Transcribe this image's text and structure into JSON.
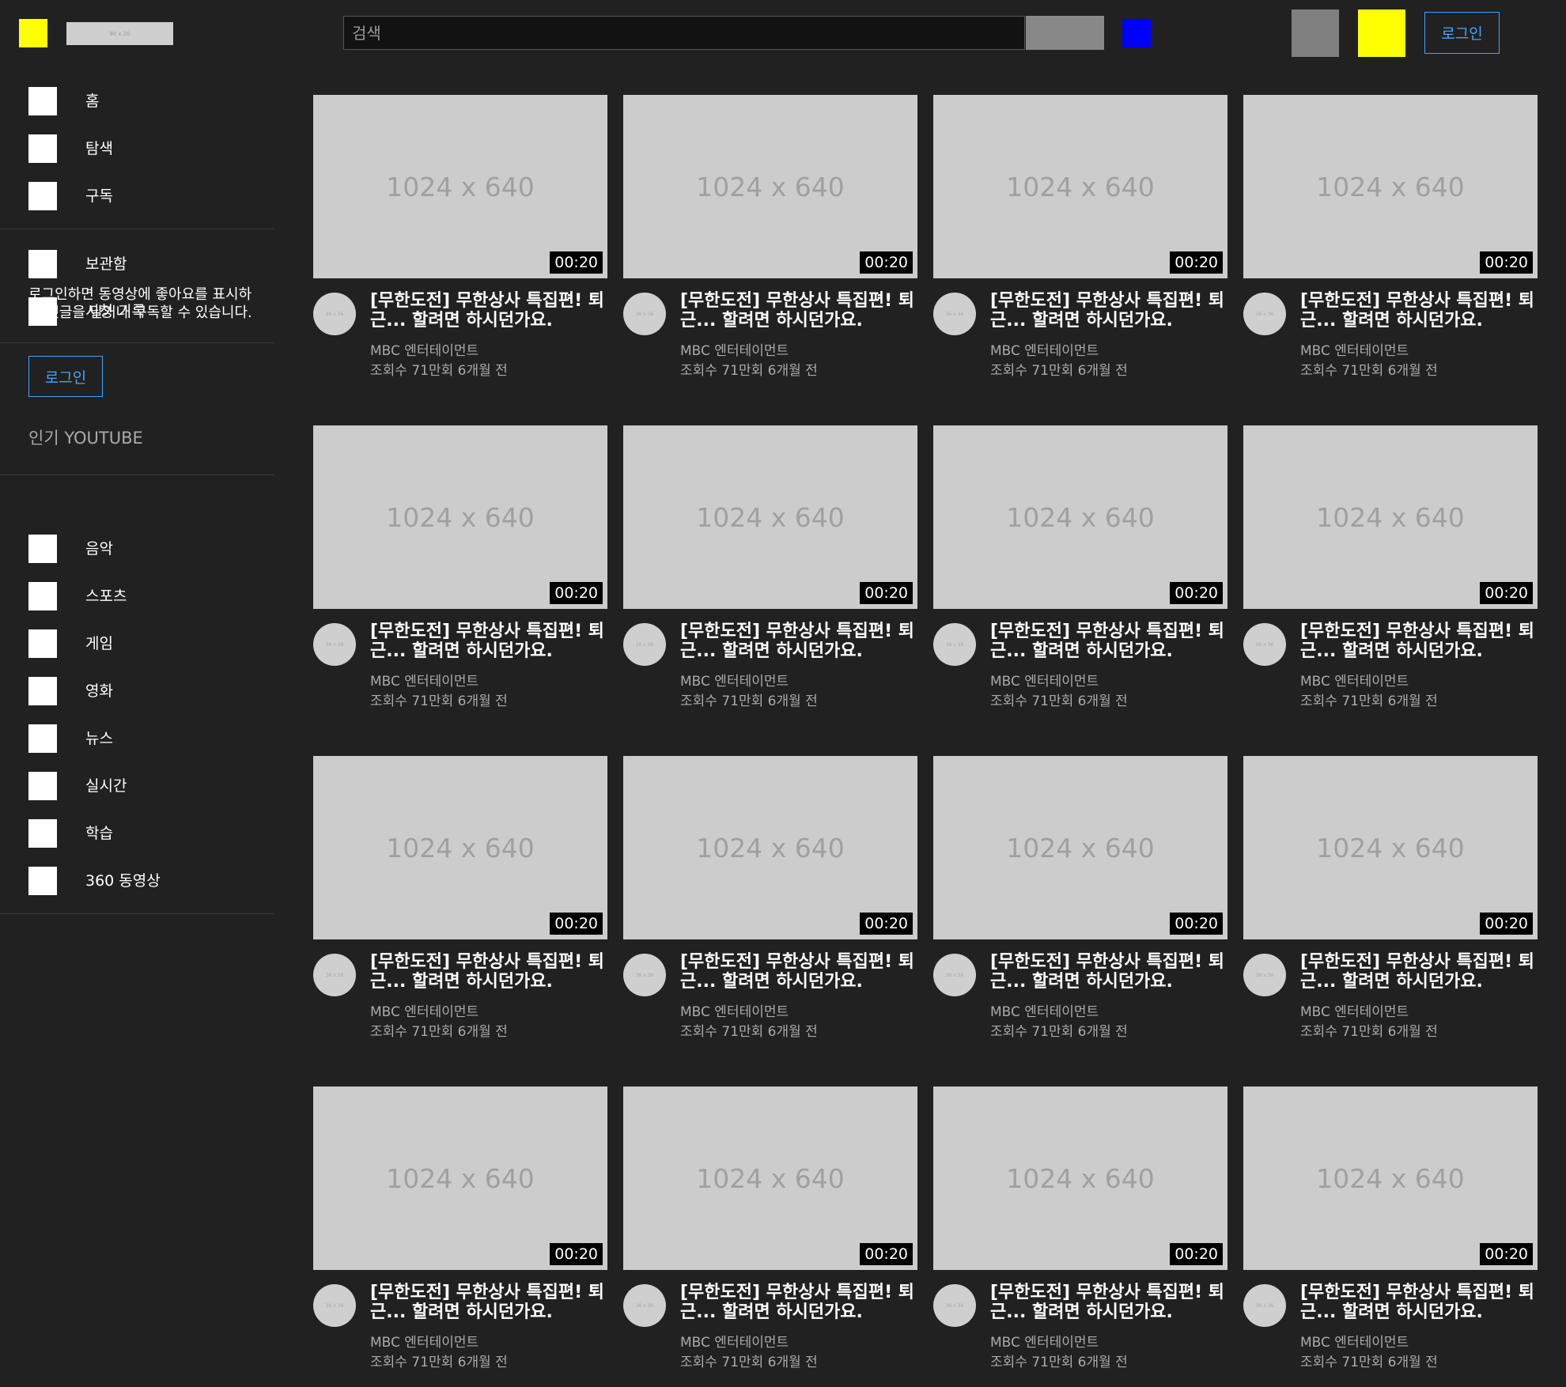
{
  "header": {
    "logo_text": "90 x 20",
    "search_placeholder": "검색",
    "login_label": "로그인"
  },
  "sidebar": {
    "main_items": [
      {
        "label": "홈",
        "icon": "home-icon"
      },
      {
        "label": "탐색",
        "icon": "explore-icon"
      },
      {
        "label": "구독",
        "icon": "subscriptions-icon"
      }
    ],
    "library_items": [
      {
        "label": "보관함",
        "icon": "library-icon"
      },
      {
        "label": "시청 기록",
        "icon": "history-icon"
      }
    ],
    "login_message": "로그인하면 동영상에 좋아요를 표시하고 댓글을 달거나 구독할 수 있습니다.",
    "login_label": "로그인",
    "popular_title": "인기 YOUTUBE",
    "popular_items": [
      {
        "label": "음악",
        "icon": "music-icon"
      },
      {
        "label": "스포츠",
        "icon": "sports-icon"
      },
      {
        "label": "게임",
        "icon": "gaming-icon"
      },
      {
        "label": "영화",
        "icon": "movies-icon"
      },
      {
        "label": "뉴스",
        "icon": "news-icon"
      },
      {
        "label": "실시간",
        "icon": "live-icon"
      },
      {
        "label": "학습",
        "icon": "learning-icon"
      },
      {
        "label": "360 동영상",
        "icon": "360-video-icon"
      }
    ]
  },
  "videos": [
    {
      "thumb": "1024 x 640",
      "duration": "00:20",
      "avatar": "36 x 36",
      "title": "[무한도전] 무한상사 특집편! 퇴근... 할려면 하시던가요.",
      "channel": "MBC 엔터테이먼트",
      "meta": "조회수 71만회 6개월 전"
    },
    {
      "thumb": "1024 x 640",
      "duration": "00:20",
      "avatar": "36 x 36",
      "title": "[무한도전] 무한상사 특집편! 퇴근... 할려면 하시던가요.",
      "channel": "MBC 엔터테이먼트",
      "meta": "조회수 71만회 6개월 전"
    },
    {
      "thumb": "1024 x 640",
      "duration": "00:20",
      "avatar": "36 x 36",
      "title": "[무한도전] 무한상사 특집편! 퇴근... 할려면 하시던가요.",
      "channel": "MBC 엔터테이먼트",
      "meta": "조회수 71만회 6개월 전"
    },
    {
      "thumb": "1024 x 640",
      "duration": "00:20",
      "avatar": "36 x 36",
      "title": "[무한도전] 무한상사 특집편! 퇴근... 할려면 하시던가요.",
      "channel": "MBC 엔터테이먼트",
      "meta": "조회수 71만회 6개월 전"
    },
    {
      "thumb": "1024 x 640",
      "duration": "00:20",
      "avatar": "36 x 36",
      "title": "[무한도전] 무한상사 특집편! 퇴근... 할려면 하시던가요.",
      "channel": "MBC 엔터테이먼트",
      "meta": "조회수 71만회 6개월 전"
    },
    {
      "thumb": "1024 x 640",
      "duration": "00:20",
      "avatar": "36 x 36",
      "title": "[무한도전] 무한상사 특집편! 퇴근... 할려면 하시던가요.",
      "channel": "MBC 엔터테이먼트",
      "meta": "조회수 71만회 6개월 전"
    },
    {
      "thumb": "1024 x 640",
      "duration": "00:20",
      "avatar": "36 x 36",
      "title": "[무한도전] 무한상사 특집편! 퇴근... 할려면 하시던가요.",
      "channel": "MBC 엔터테이먼트",
      "meta": "조회수 71만회 6개월 전"
    },
    {
      "thumb": "1024 x 640",
      "duration": "00:20",
      "avatar": "36 x 36",
      "title": "[무한도전] 무한상사 특집편! 퇴근... 할려면 하시던가요.",
      "channel": "MBC 엔터테이먼트",
      "meta": "조회수 71만회 6개월 전"
    },
    {
      "thumb": "1024 x 640",
      "duration": "00:20",
      "avatar": "36 x 36",
      "title": "[무한도전] 무한상사 특집편! 퇴근... 할려면 하시던가요.",
      "channel": "MBC 엔터테이먼트",
      "meta": "조회수 71만회 6개월 전"
    },
    {
      "thumb": "1024 x 640",
      "duration": "00:20",
      "avatar": "36 x 36",
      "title": "[무한도전] 무한상사 특집편! 퇴근... 할려면 하시던가요.",
      "channel": "MBC 엔터테이먼트",
      "meta": "조회수 71만회 6개월 전"
    },
    {
      "thumb": "1024 x 640",
      "duration": "00:20",
      "avatar": "36 x 36",
      "title": "[무한도전] 무한상사 특집편! 퇴근... 할려면 하시던가요.",
      "channel": "MBC 엔터테이먼트",
      "meta": "조회수 71만회 6개월 전"
    },
    {
      "thumb": "1024 x 640",
      "duration": "00:20",
      "avatar": "36 x 36",
      "title": "[무한도전] 무한상사 특집편! 퇴근... 할려면 하시던가요.",
      "channel": "MBC 엔터테이먼트",
      "meta": "조회수 71만회 6개월 전"
    },
    {
      "thumb": "1024 x 640",
      "duration": "00:20",
      "avatar": "36 x 36",
      "title": "[무한도전] 무한상사 특집편! 퇴근... 할려면 하시던가요.",
      "channel": "MBC 엔터테이먼트",
      "meta": "조회수 71만회 6개월 전"
    },
    {
      "thumb": "1024 x 640",
      "duration": "00:20",
      "avatar": "36 x 36",
      "title": "[무한도전] 무한상사 특집편! 퇴근... 할려면 하시던가요.",
      "channel": "MBC 엔터테이먼트",
      "meta": "조회수 71만회 6개월 전"
    },
    {
      "thumb": "1024 x 640",
      "duration": "00:20",
      "avatar": "36 x 36",
      "title": "[무한도전] 무한상사 특집편! 퇴근... 할려면 하시던가요.",
      "channel": "MBC 엔터테이먼트",
      "meta": "조회수 71만회 6개월 전"
    },
    {
      "thumb": "1024 x 640",
      "duration": "00:20",
      "avatar": "36 x 36",
      "title": "[무한도전] 무한상사 특집편! 퇴근... 할려면 하시던가요.",
      "channel": "MBC 엔터테이먼트",
      "meta": "조회수 71만회 6개월 전"
    }
  ]
}
